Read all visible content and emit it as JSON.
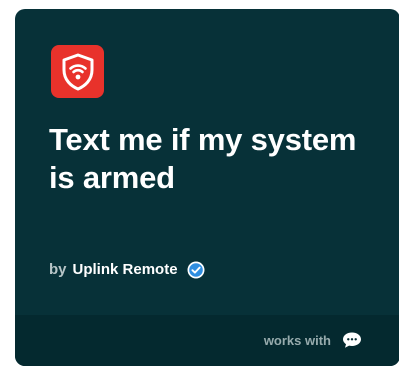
{
  "applet": {
    "service_icon": "shield-wifi-icon",
    "title": "Text me if my system is armed",
    "by_label": "by",
    "author": "Uplink Remote",
    "verified_icon": "verified-check-icon",
    "works_with_label": "works with",
    "works_with_icon": "chat-bubble-icon"
  },
  "colors": {
    "card_background": "#073138",
    "footer_background": "#04292f",
    "service_brand": "#e8322b",
    "verified_badge": "#2f8ee0"
  }
}
